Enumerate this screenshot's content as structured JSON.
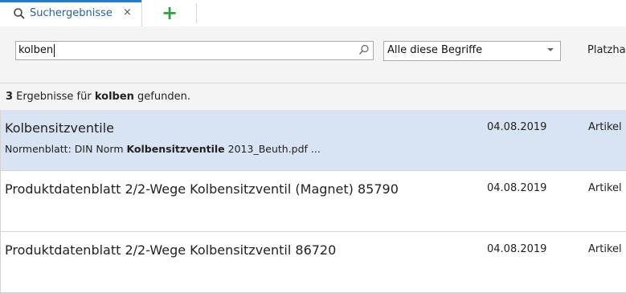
{
  "tab": {
    "label": "Suchergebnisse",
    "close_icon": "×",
    "add_icon": "+"
  },
  "search": {
    "query": "kolben",
    "mode_selected": "Alle diese Begriffe",
    "next_column_label": "Platzha"
  },
  "summary": {
    "count": "3",
    "text_before": " Ergebnisse für ",
    "term": "kolben",
    "text_after": " gefunden."
  },
  "results": [
    {
      "title": "Kolbensitzventile",
      "snippet_before": "Normenblatt: DIN Norm ",
      "snippet_bold": "Kolbensitzventile",
      "snippet_after": " 2013_Beuth.pdf  ...",
      "date": "04.08.2019",
      "type": "Artikel"
    },
    {
      "title": "Produktdatenblatt 2/2-Wege Kolbensitzventil (Magnet) 85790",
      "date": "04.08.2019",
      "type": "Artikel"
    },
    {
      "title": "Produktdatenblatt 2/2-Wege Kolbensitzventil 86720",
      "date": "04.08.2019",
      "type": "Artikel"
    }
  ],
  "colors": {
    "accent": "#2b78c5",
    "selected_row": "#d8e3f3",
    "add_icon": "#2ea043"
  }
}
